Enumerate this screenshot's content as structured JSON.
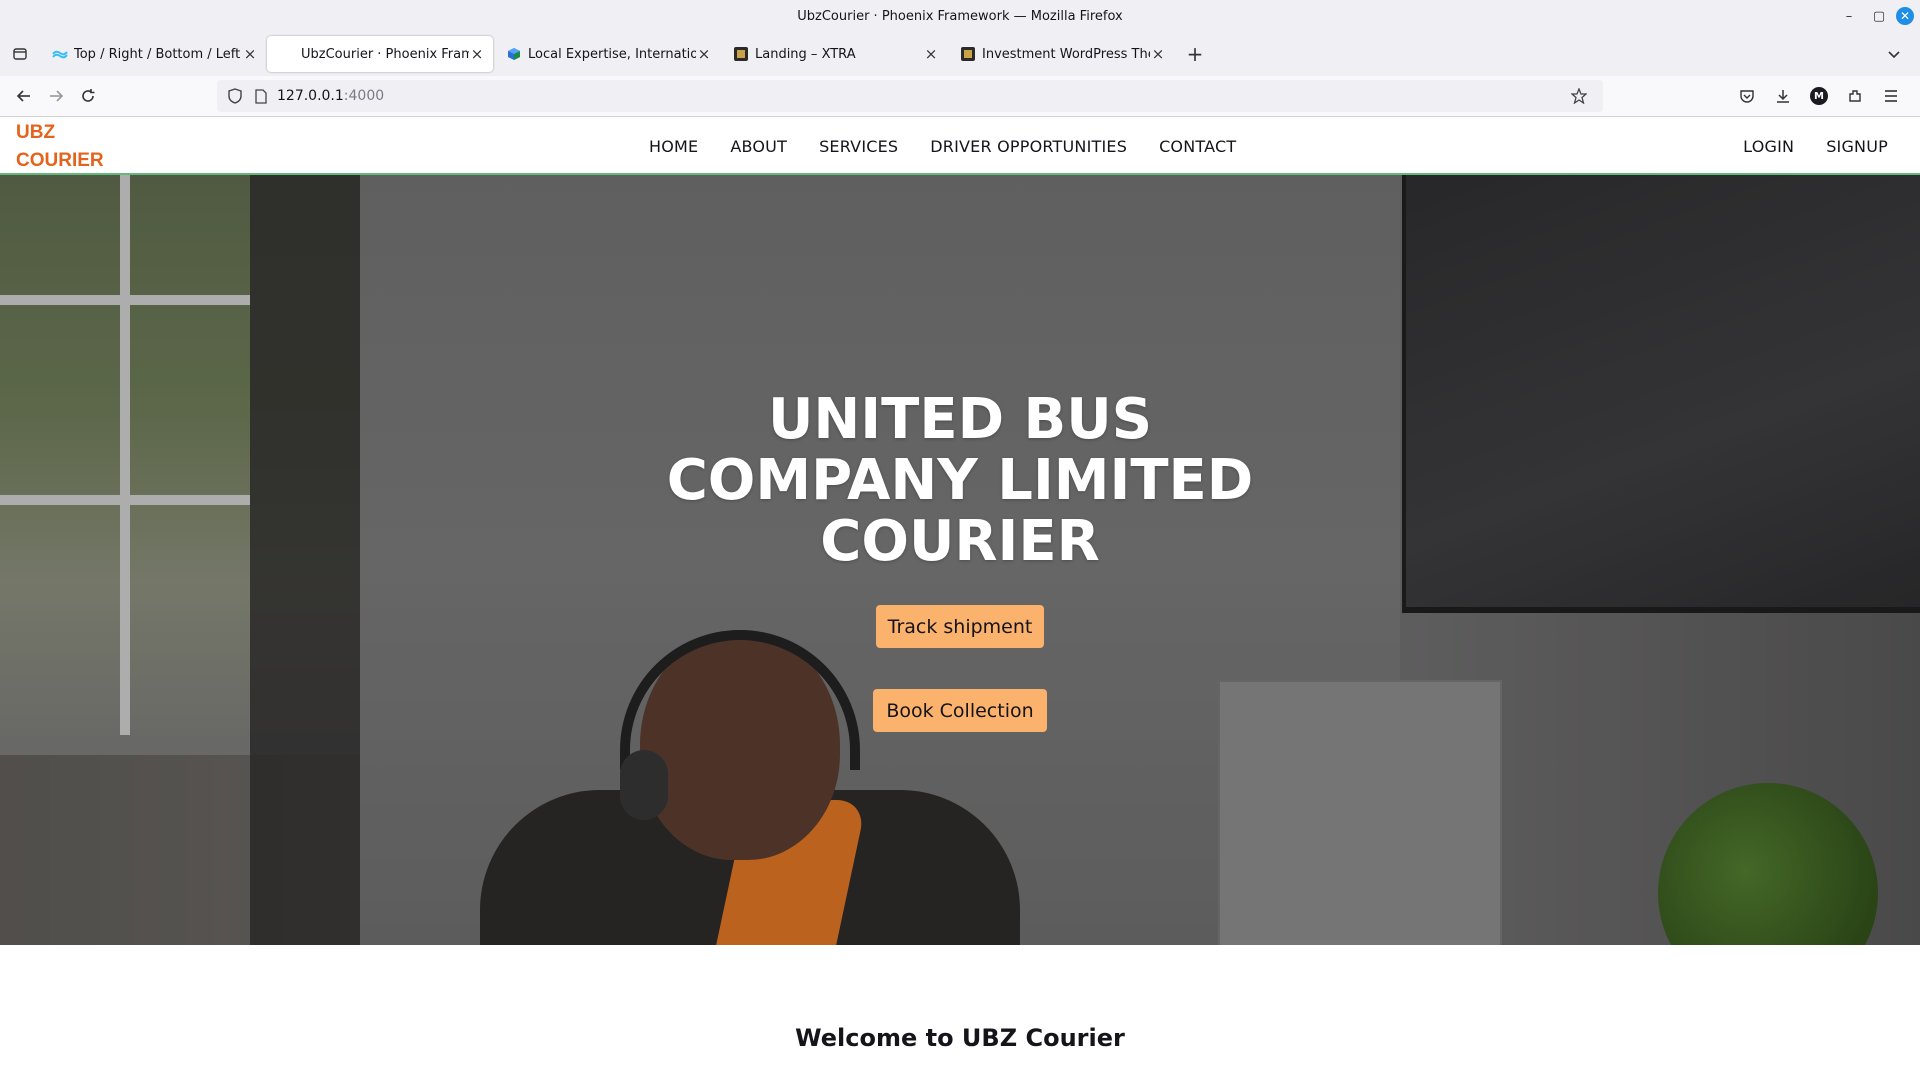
{
  "window": {
    "title": "UbzCourier · Phoenix Framework — Mozilla Firefox",
    "minimize": "–",
    "maximize": "▢",
    "close": "✕"
  },
  "tabs": [
    {
      "title": "Top / Right / Bottom / Left",
      "active": false,
      "favicon": "tailwind-icon"
    },
    {
      "title": "UbzCourier · Phoenix Framew",
      "active": true,
      "favicon": "page-icon"
    },
    {
      "title": "Local Expertise, Internation",
      "active": false,
      "favicon": "cube-icon"
    },
    {
      "title": "Landing – XTRA",
      "active": false,
      "favicon": "xtra-icon"
    },
    {
      "title": "Investment WordPress Ther",
      "active": false,
      "favicon": "xtra-icon"
    }
  ],
  "url": {
    "host": "127.0.0.1",
    "port": ":4000"
  },
  "toolbar": {
    "account_initial": "M"
  },
  "site": {
    "logo_line1": "UBZ",
    "logo_line2": "COURIER",
    "nav": [
      "HOME",
      "ABOUT",
      "SERVICES",
      "DRIVER OPPORTUNITIES",
      "CONTACT"
    ],
    "login": "LOGIN",
    "signup": "SIGNUP",
    "hero": {
      "title_line1": "UNITED BUS",
      "title_line2": "COMPANY LIMITED",
      "title_line3": "COURIER",
      "track_button": "Track shipment",
      "book_button": "Book Collection"
    },
    "welcome_heading": "Welcome to UBZ Courier"
  },
  "colors": {
    "brand_orange": "#e3641c",
    "button_orange": "#fbb26d",
    "header_border_green": "#63b87b"
  }
}
